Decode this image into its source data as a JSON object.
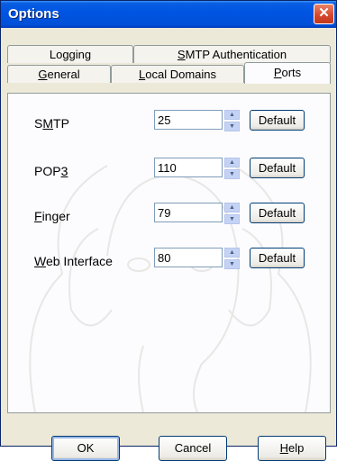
{
  "window": {
    "title": "Options",
    "close_glyph": "✕"
  },
  "tabs": {
    "row_back": [
      {
        "label": "Logging",
        "mnemonic": ""
      },
      {
        "label": "SMTP Authentication",
        "mnemonic": "S"
      }
    ],
    "row_front": [
      {
        "label": "General",
        "mnemonic": "G"
      },
      {
        "label": "Local Domains",
        "mnemonic": "L"
      },
      {
        "label": "Ports",
        "mnemonic": "P",
        "active": true
      }
    ]
  },
  "ports": {
    "smtp": {
      "label_pre": "S",
      "label_mn": "M",
      "label_post": "TP",
      "value": "25"
    },
    "pop3": {
      "label_pre": "POP",
      "label_mn": "3",
      "label_post": "",
      "value": "110"
    },
    "finger": {
      "label_pre": "",
      "label_mn": "F",
      "label_post": "inger",
      "value": "79"
    },
    "web": {
      "label_pre": "",
      "label_mn": "W",
      "label_post": "eb Interface",
      "value": "80"
    },
    "default_label": "Default"
  },
  "buttons": {
    "ok": "OK",
    "cancel": "Cancel",
    "help_mn": "H",
    "help_rest": "elp"
  },
  "colors": {
    "titlebar": "#0054e3",
    "close": "#d5452a",
    "face": "#ece9d8"
  },
  "icons": {
    "close": "close-icon",
    "spin_up": "up-arrow-icon",
    "spin_down": "down-arrow-icon"
  }
}
